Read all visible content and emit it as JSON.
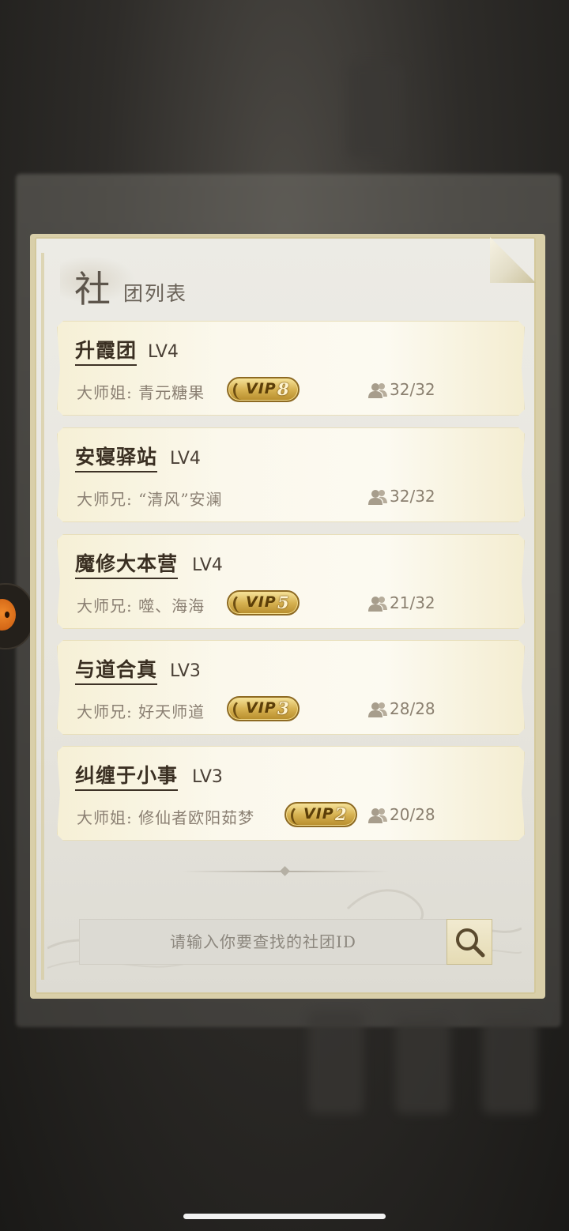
{
  "panel": {
    "title_first_char": "社",
    "title_rest": "团列表"
  },
  "clubs": [
    {
      "name": "升霞团",
      "level": "LV4",
      "leader": "大师姐: 青元糖果",
      "vip": "8",
      "members": "32/32"
    },
    {
      "name": "安寝驿站",
      "level": "LV4",
      "leader": "大师兄: “清风”安澜",
      "vip": null,
      "members": "32/32"
    },
    {
      "name": "魔修大本营",
      "level": "LV4",
      "leader": "大师兄: 噬、海海",
      "vip": "5",
      "members": "21/32"
    },
    {
      "name": "与道合真",
      "level": "LV3",
      "leader": "大师兄: 好天师道",
      "vip": "3",
      "members": "28/28"
    },
    {
      "name": "纠缠于小事",
      "level": "LV3",
      "leader": "大师姐: 修仙者欧阳茹梦",
      "vip": "2",
      "members": "20/28"
    }
  ],
  "vip_label": "VIP",
  "search": {
    "placeholder": "请输入你要查找的社团ID"
  },
  "icons": {
    "members": "people-icon",
    "search": "magnifier-icon"
  },
  "colors": {
    "accent_gold": "#d7b252",
    "text_dark": "#3a2f22",
    "text_muted": "#8a7f72"
  }
}
